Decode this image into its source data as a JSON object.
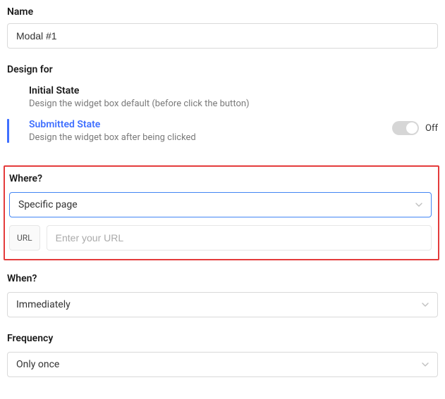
{
  "name": {
    "label": "Name",
    "value": "Modal #1"
  },
  "design_for": {
    "label": "Design for",
    "states": [
      {
        "title": "Initial State",
        "desc": "Design the widget box default (before click the button)",
        "active": false
      },
      {
        "title": "Submitted State",
        "desc": "Design the widget box after being clicked",
        "active": true,
        "toggle_label": "Off"
      }
    ]
  },
  "where": {
    "label": "Where?",
    "select_value": "Specific page",
    "url_prefix": "URL",
    "url_placeholder": "Enter your URL",
    "url_value": ""
  },
  "when": {
    "label": "When?",
    "select_value": "Immediately"
  },
  "frequency": {
    "label": "Frequency",
    "select_value": "Only once"
  }
}
